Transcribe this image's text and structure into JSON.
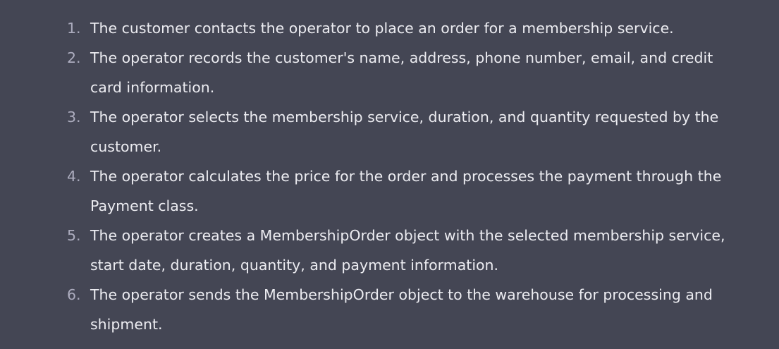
{
  "steps": [
    {
      "number": "1.",
      "text": "The customer contacts the operator to place an order for a membership service."
    },
    {
      "number": "2.",
      "text": "The operator records the customer's name, address, phone number, email, and credit card information."
    },
    {
      "number": "3.",
      "text": "The operator selects the membership service, duration, and quantity requested by the customer."
    },
    {
      "number": "4.",
      "text": "The operator calculates the price for the order and processes the payment through the Payment class."
    },
    {
      "number": "5.",
      "text": "The operator creates a MembershipOrder object with the selected membership service, start date, duration, quantity, and payment information."
    },
    {
      "number": "6.",
      "text": "The operator sends the MembershipOrder object to the warehouse for processing and shipment."
    }
  ]
}
